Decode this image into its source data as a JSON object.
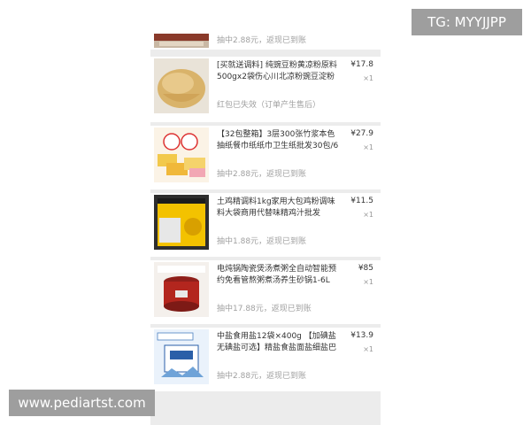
{
  "watermarks": {
    "top_right": "TG: MYYJJPP",
    "bottom_left": "www.pediartst.com"
  },
  "orders": [
    {
      "title": "",
      "price": "",
      "qty": "",
      "note": "抽中2.88元，返现已到账",
      "image": "partial-product-thumbnail"
    },
    {
      "title": "[买就送调料] 纯豌豆粉黄凉粉原料500gx2袋伤心川北凉粉豌豆淀粉",
      "price": "¥17.8",
      "qty": "×1",
      "note": "红包已失效（订单产生售后）",
      "image": "pea-starch-jelly-thumbnail"
    },
    {
      "title": "【32包整箱】3层300张竹浆本色抽纸餐巾纸纸巾卫生纸批发30包/6",
      "price": "¥27.9",
      "qty": "×1",
      "note": "抽中2.88元，返现已到账",
      "image": "tissue-box-thumbnail"
    },
    {
      "title": "土鸡精调料1kg家用大包鸡粉调味料大袋商用代替味精鸡汁批发",
      "price": "¥11.5",
      "qty": "×1",
      "note": "抽中1.88元，返现已到账",
      "image": "chicken-essence-thumbnail"
    },
    {
      "title": "电炖锅陶瓷煲汤煮粥全自动智能预约免看管熬粥煮汤养生砂锅1-6L",
      "price": "¥85",
      "qty": "×1",
      "note": "抽中17.88元，返现已到账",
      "image": "electric-stew-pot-thumbnail"
    },
    {
      "title": "中盐食用盐12袋×400g 【加碘盐无碘盐可选】精盐食盐面盐细盐巴",
      "price": "¥13.9",
      "qty": "×1",
      "note": "抽中2.88元，返现已到账",
      "image": "salt-packs-thumbnail"
    }
  ]
}
